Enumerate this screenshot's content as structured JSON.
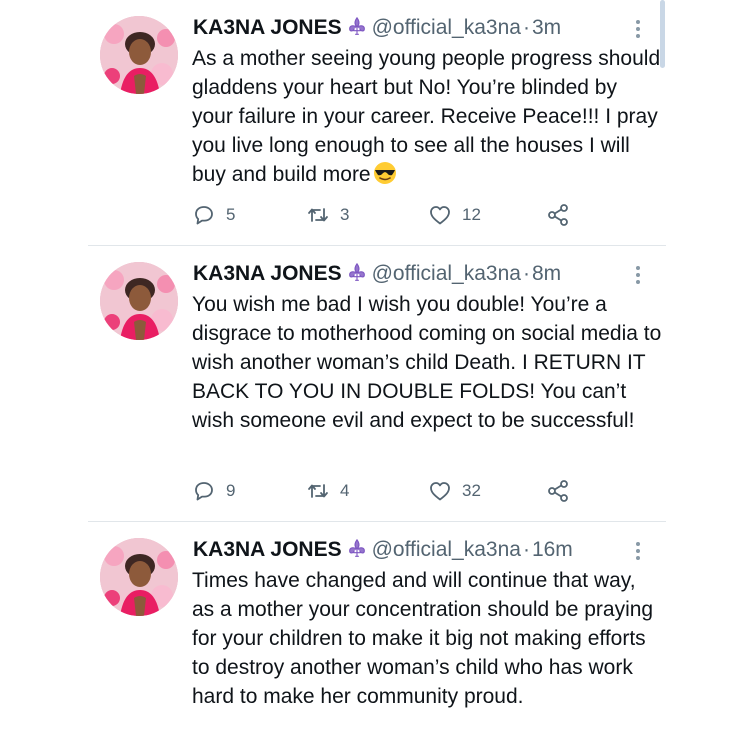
{
  "tweets": [
    {
      "name": "KA3NA JONES",
      "handle": "@official_ka3na",
      "separator": "·",
      "time": "3m",
      "text": "As a mother seeing young people progress should gladdens your heart but No! You’re blinded by your failure in your career. Receive Peace!!! I pray you live long enough to see all the houses I will buy and build more",
      "emoji": "smiling-face-with-sunglasses",
      "replies": "5",
      "retweets": "3",
      "likes": "12"
    },
    {
      "name": "KA3NA JONES",
      "handle": "@official_ka3na",
      "separator": "·",
      "time": "8m",
      "text": "You wish me bad I wish you double! You’re a disgrace to motherhood coming on social media to wish another woman’s child Death. I RETURN IT BACK TO YOU IN DOUBLE FOLDS! You can’t wish someone evil and expect to be successful!",
      "replies": "9",
      "retweets": "4",
      "likes": "32"
    },
    {
      "name": "KA3NA JONES",
      "handle": "@official_ka3na",
      "separator": "·",
      "time": "16m",
      "text": "Times have changed and will continue that way, as a mother your concentration should be praying for your children to make it big not making efforts to destroy another woman’s child who has work hard to make her community proud."
    }
  ],
  "icons": {
    "badge": "fleur-de-lis-icon",
    "more": "more-vertical-icon",
    "reply": "reply-icon",
    "retweet": "retweet-icon",
    "like": "heart-icon",
    "share": "share-icon"
  },
  "colors": {
    "text": "#0f1419",
    "secondary": "#536471",
    "badge": "#7e57c2",
    "divider": "#e1e6ea",
    "scrollbar": "#c9d7e6"
  }
}
